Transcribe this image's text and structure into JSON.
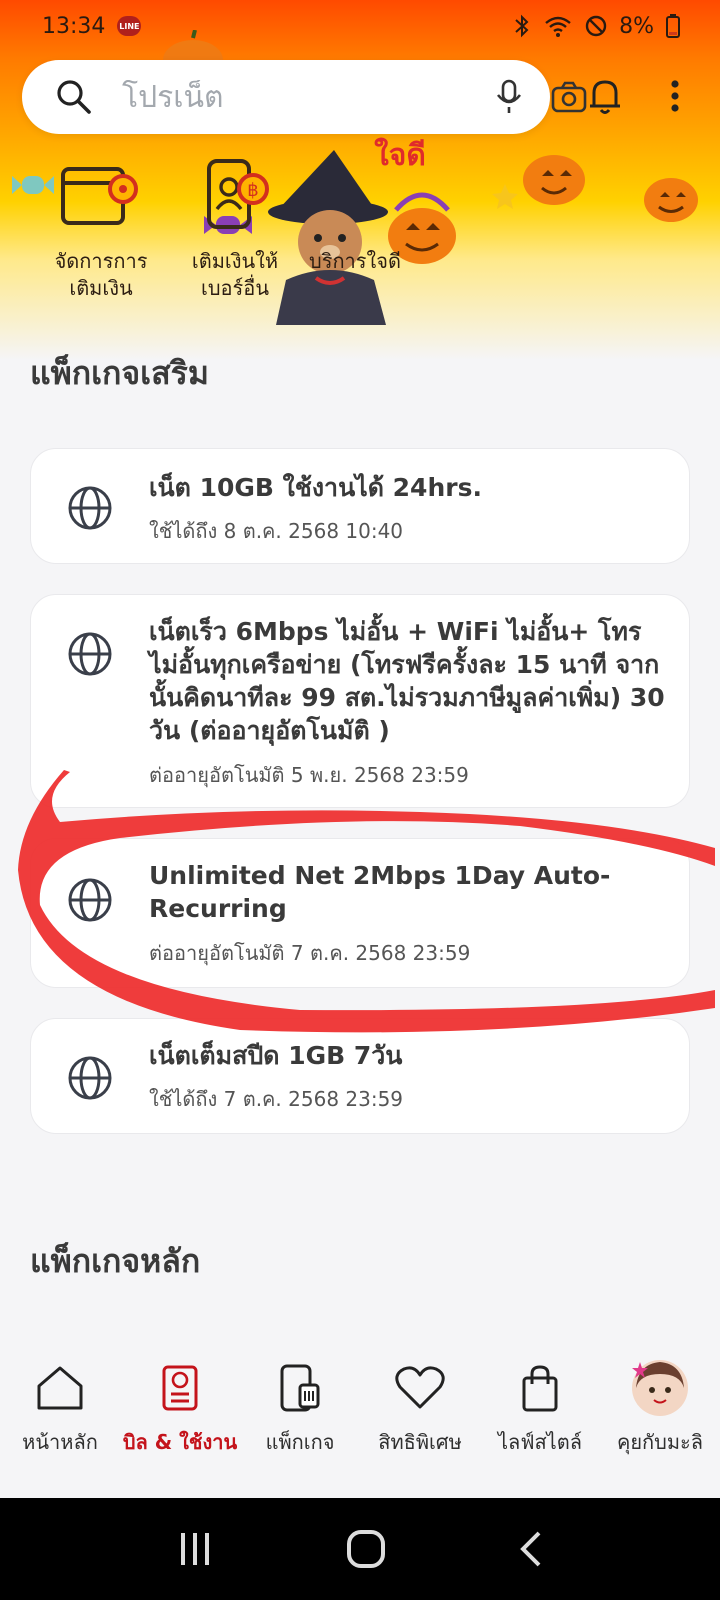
{
  "status": {
    "time": "13:34",
    "line_badge": "LINE",
    "battery": "8%"
  },
  "search": {
    "placeholder": "โปรเน็ต"
  },
  "quick_actions": [
    {
      "label": "จัดการการ\nเติมเงิน",
      "icon": "wallet-gear-icon"
    },
    {
      "label": "เติมเงินให้\nเบอร์อื่น",
      "icon": "phone-baht-icon"
    },
    {
      "label": "บริการใจดี",
      "badge": "ใจดี",
      "icon": "heart-jaidee-icon"
    }
  ],
  "sections": {
    "addon_title": "แพ็กเกจเสริม",
    "main_title": "แพ็กเกจหลัก"
  },
  "addon_packages": [
    {
      "title": "เน็ต 10GB ใช้งานได้ 24hrs.",
      "subtitle": "ใช้ได้ถึง 8 ต.ค. 2568 10:40",
      "icon": "globe-icon"
    },
    {
      "title": "เน็ตเร็ว 6Mbps ไม่อั้น + WiFi ไม่อั้น+ โทรไม่อั้นทุกเครือข่าย (โทรฟรีครั้งละ 15 นาที จากนั้นคิดนาทีละ 99 สต.ไม่รวมภาษีมูลค่าเพิ่ม) 30 วัน (ต่ออายุอัตโนมัติ )",
      "subtitle": "ต่ออายุอัตโนมัติ 5 พ.ย. 2568 23:59",
      "icon": "globe-icon"
    },
    {
      "title": "Unlimited Net 2Mbps 1Day Auto-Recurring",
      "subtitle": "ต่ออายุอัตโนมัติ 7 ต.ค. 2568 23:59",
      "icon": "globe-icon"
    },
    {
      "title": "เน็ตเต็มสปีด 1GB 7วัน",
      "subtitle": "ใช้ได้ถึง 7 ต.ค. 2568 23:59",
      "icon": "globe-icon"
    }
  ],
  "bottom_nav": [
    {
      "label": "หน้าหลัก",
      "icon": "home-icon",
      "active": false
    },
    {
      "label": "บิล & ใช้งาน",
      "icon": "bill-icon",
      "active": true
    },
    {
      "label": "แพ็กเกจ",
      "icon": "sim-phone-icon",
      "active": false
    },
    {
      "label": "สิทธิพิเศษ",
      "icon": "heart-icon",
      "active": false
    },
    {
      "label": "ไลฟ์สไตล์",
      "icon": "shopping-bag-icon",
      "active": false
    },
    {
      "label": "คุยกับมะลิ",
      "icon": "avatar-mali-icon",
      "active": false
    }
  ],
  "colors": {
    "accent": "#c4131b",
    "annotation": "#ee2b2b"
  }
}
